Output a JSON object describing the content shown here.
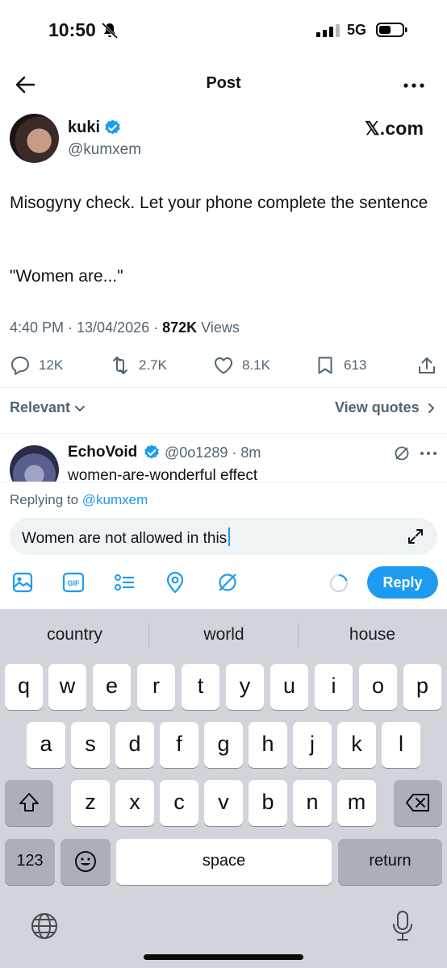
{
  "status_bar": {
    "time": "10:50",
    "network": "5G",
    "icons": [
      "bell-slash-icon",
      "signal-icon",
      "battery-icon"
    ]
  },
  "nav": {
    "title": "Post",
    "icons": [
      "back-arrow-icon",
      "more-icon"
    ]
  },
  "post": {
    "author_name": "kuki",
    "author_handle": "@kumxem",
    "watermark": "𝕏.com",
    "text": "Misogyny check. Let your phone complete the sentence",
    "quote": "\"Women are...\"",
    "timestamp": "4:40 PM · 13/04/2026 · ",
    "views_count": "872K",
    "views_label": " Views",
    "replies": "12K",
    "reposts": "2.7K",
    "likes": "8.1K",
    "bookmarks": "613"
  },
  "filter": {
    "sort_label": "Relevant",
    "view_quotes": "View quotes"
  },
  "reply_preview": {
    "name": "EchoVoid",
    "handle": "@0o1289 · 8m",
    "text": "women-are-wonderful effect"
  },
  "composer": {
    "replying_prefix": "Replying to ",
    "replying_handle": "@kumxem",
    "value": "Women are not allowed in this",
    "reply_button": "Reply",
    "tools": [
      "image-icon",
      "gif-icon",
      "poll-icon",
      "location-icon",
      "grok-icon"
    ]
  },
  "keyboard": {
    "suggestions": [
      "country",
      "world",
      "house"
    ],
    "row1": [
      "q",
      "w",
      "e",
      "r",
      "t",
      "y",
      "u",
      "i",
      "o",
      "p"
    ],
    "row2": [
      "a",
      "s",
      "d",
      "f",
      "g",
      "h",
      "j",
      "k",
      "l"
    ],
    "row3": [
      "z",
      "x",
      "c",
      "v",
      "b",
      "n",
      "m"
    ],
    "numbers_key": "123",
    "space_key": "space",
    "return_key": "return"
  },
  "colors": {
    "accent": "#1d9bf0",
    "muted": "#536471",
    "keyboard_bg": "#d1d4db"
  }
}
